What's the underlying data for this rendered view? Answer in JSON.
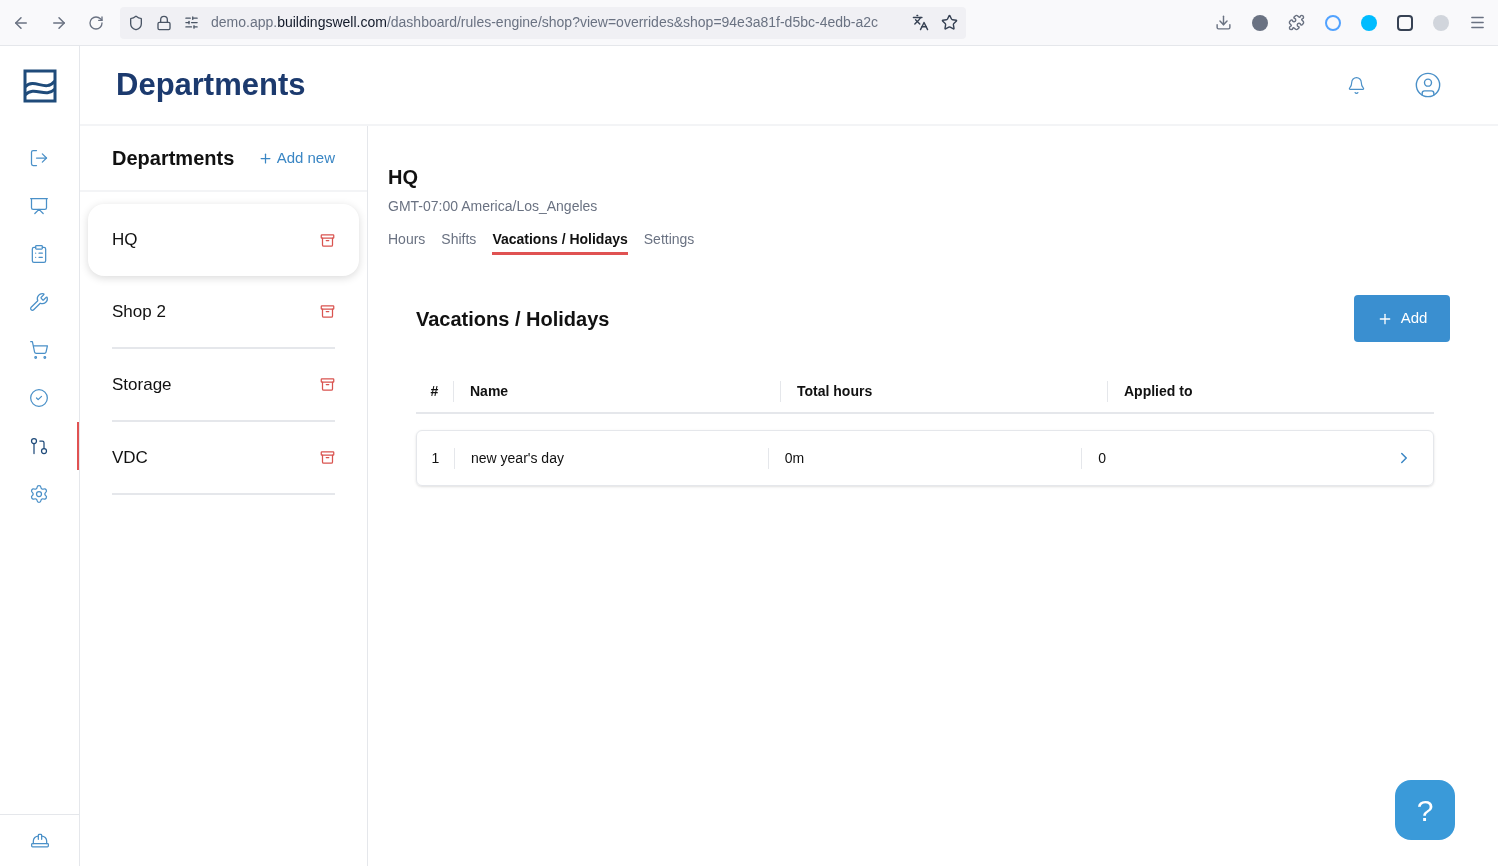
{
  "browser": {
    "url_prefix": "demo.app.",
    "url_domain": "buildingswell.com",
    "url_path": "/dashboard/rules-engine/shop?view=overrides&shop=94e3a81f-d5bc-4edb-a2c"
  },
  "nav": [
    {
      "kind": "logout",
      "selected": false
    },
    {
      "kind": "chart",
      "selected": false
    },
    {
      "kind": "clipboard",
      "selected": false
    },
    {
      "kind": "wrench",
      "selected": false
    },
    {
      "kind": "cart",
      "selected": false
    },
    {
      "kind": "check",
      "selected": false
    },
    {
      "kind": "rules",
      "selected": true
    },
    {
      "kind": "settings",
      "selected": false
    }
  ],
  "header": {
    "title": "Departments"
  },
  "departments_panel": {
    "title": "Departments",
    "add_label": "Add new",
    "items": [
      {
        "name": "HQ",
        "selected": true
      },
      {
        "name": "Shop 2",
        "selected": false
      },
      {
        "name": "Storage",
        "selected": false
      },
      {
        "name": "VDC",
        "selected": false
      }
    ]
  },
  "detail": {
    "name": "HQ",
    "timezone": "GMT-07:00 America/Los_Angeles",
    "tabs": [
      {
        "label": "Hours",
        "selected": false
      },
      {
        "label": "Shifts",
        "selected": false
      },
      {
        "label": "Vacations / Holidays",
        "selected": true
      },
      {
        "label": "Settings",
        "selected": false
      }
    ],
    "section_title": "Vacations / Holidays",
    "add_button": "Add",
    "table": {
      "columns": [
        "#",
        "Name",
        "Total hours",
        "Applied to"
      ],
      "rows": [
        [
          "1",
          "new year's day",
          "0m",
          "0"
        ]
      ]
    }
  },
  "help_button": "?"
}
